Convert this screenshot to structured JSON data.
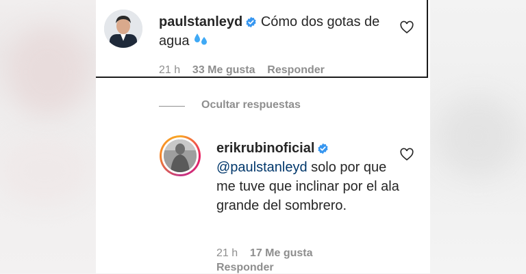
{
  "comment1": {
    "username": "paulstanleyd",
    "text": "Cómo dos gotas de agua",
    "emoji": "💦",
    "time": "21 h",
    "likes": "33 Me gusta",
    "reply": "Responder"
  },
  "replies_toggle": "Ocultar respuestas",
  "comment2": {
    "username": "erikrubinoficial",
    "mention": "@paulstanleyd",
    "text": " solo por que me tuve que inclinar por el ala grande del sombrero.",
    "time": "21 h",
    "likes": "17 Me gusta",
    "reply": "Responder"
  },
  "colors": {
    "verified": "#3897f0",
    "mention": "#00376b",
    "meta": "#8e8e8e"
  }
}
